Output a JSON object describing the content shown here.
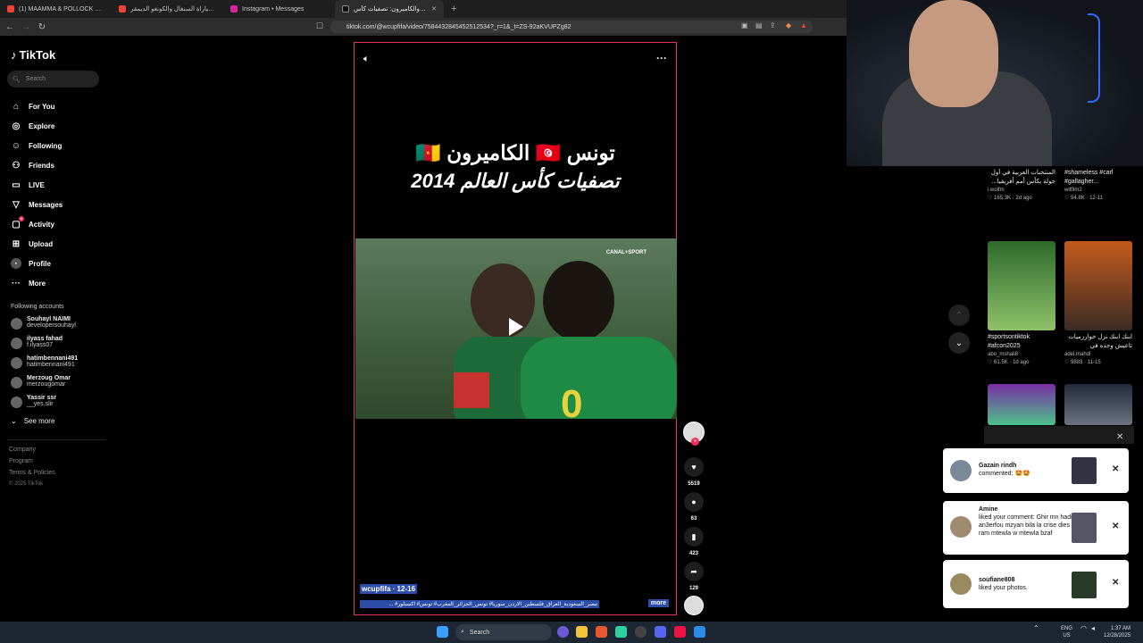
{
  "browser": {
    "tabs": [
      {
        "title": "(1) MAAMMA & POLLOCK SEAL LEG"
      },
      {
        "title": "ملخص مباراة السنغال والكونغو الديمقر"
      },
      {
        "title": "Instagram • Messages"
      },
      {
        "title": "تونس والكاميرون: تصفيات كأس"
      }
    ],
    "url": "tiktok.com/@wcupfifa/video/7584432845452512534?_r=1&_t=ZS-92aKVUPZg82"
  },
  "sidebar": {
    "logo": "TikTok",
    "search_placeholder": "Search",
    "nav": [
      {
        "label": "For You",
        "icon": "home-icon"
      },
      {
        "label": "Explore",
        "icon": "compass-icon"
      },
      {
        "label": "Following",
        "icon": "following-icon"
      },
      {
        "label": "Friends",
        "icon": "friends-icon"
      },
      {
        "label": "LIVE",
        "icon": "live-icon"
      },
      {
        "label": "Messages",
        "icon": "messages-icon"
      },
      {
        "label": "Activity",
        "icon": "activity-icon",
        "badge": "6"
      },
      {
        "label": "Upload",
        "icon": "upload-icon"
      },
      {
        "label": "Profile",
        "icon": "profile-icon"
      },
      {
        "label": "More",
        "icon": "more-icon"
      }
    ],
    "following_heading": "Following accounts",
    "accounts": [
      {
        "name": "Souhayl NAIMI",
        "handle": "developersouhayl"
      },
      {
        "name": "ilyass fahad",
        "handle": "f.ilyass07"
      },
      {
        "name": "hatimbennani491",
        "handle": "hatimbennani491"
      },
      {
        "name": "Merzoug Omar",
        "handle": "merzougomar"
      },
      {
        "name": "Yassir ssr",
        "handle": "__yes.slir"
      }
    ],
    "see_more": "See more",
    "footer": [
      "Company",
      "Program",
      "Terms & Policies"
    ],
    "copyright": "© 2025 TikTok"
  },
  "video": {
    "headline_line1": "تونس 🇹🇳 الكاميرون 🇨🇲",
    "headline_line2": "تصفيات كأس العالم 2014",
    "channel_watermark": "CANAL+SPORT",
    "author_line": "wcupfifa · 12-16",
    "caption": "مصر_السعودية_العراق_فلسطين_الاردن_سوريا# تونس_الجزائر_المغرب# تونس# اكسبلور# ...",
    "more_label": "more",
    "likes": "5519",
    "comments": "63",
    "saves": "423",
    "shares": "129"
  },
  "recommended": [
    {
      "caption": "المنتخبات العربية في أول جولة بكأس أمم أفريقيا...",
      "author": "i.wolfm",
      "likes": "165.3K",
      "age": "2d ago",
      "colors": [
        "#2d6a35",
        "#a3c69b"
      ]
    },
    {
      "caption": "#shameless #carl #gallagher...",
      "author": "wilfilm2",
      "likes": "94.8K",
      "age": "12-11",
      "colors": [
        "#7a5a44",
        "#3a2b22"
      ]
    },
    {
      "caption": "#sportsontiktok #afcon2025",
      "author": "abo_mshali8",
      "likes": "61.5K",
      "age": "1d ago",
      "colors": [
        "#2e6a2c",
        "#8fc36a"
      ]
    },
    {
      "caption": "ابنك ابنك نزل خوارزميات تاعيش وحده في المعلومات",
      "author": "adel.mahdi",
      "likes": "9883",
      "age": "11-15",
      "colors": [
        "#c55a1d",
        "#3b2b24"
      ]
    },
    {
      "caption": "",
      "author": "",
      "likes": "",
      "age": "",
      "colors": [
        "#7a2fa5",
        "#4cc08a"
      ]
    },
    {
      "caption": "",
      "author": "",
      "likes": "",
      "age": "",
      "colors": [
        "#222a3a",
        "#6b7280"
      ]
    }
  ],
  "notifications": [
    {
      "name": "Gazain rindh",
      "text": "commented: 🤩🤩"
    },
    {
      "name": "Amine",
      "text": "liked your comment: Ghir mn hadi an3erfou mzyan bila la crise dies ram mtewla w mtewla bzaf"
    },
    {
      "name": "soufiane808",
      "text": "liked your photos."
    }
  ],
  "taskbar": {
    "search": "Search",
    "lang": "ENG",
    "region": "US",
    "time": "1:37 AM",
    "date": "12/28/2025"
  },
  "colors": {
    "accent": "#fe2c55",
    "frame": "#e0354b",
    "highlight": "#2c4ea8"
  }
}
